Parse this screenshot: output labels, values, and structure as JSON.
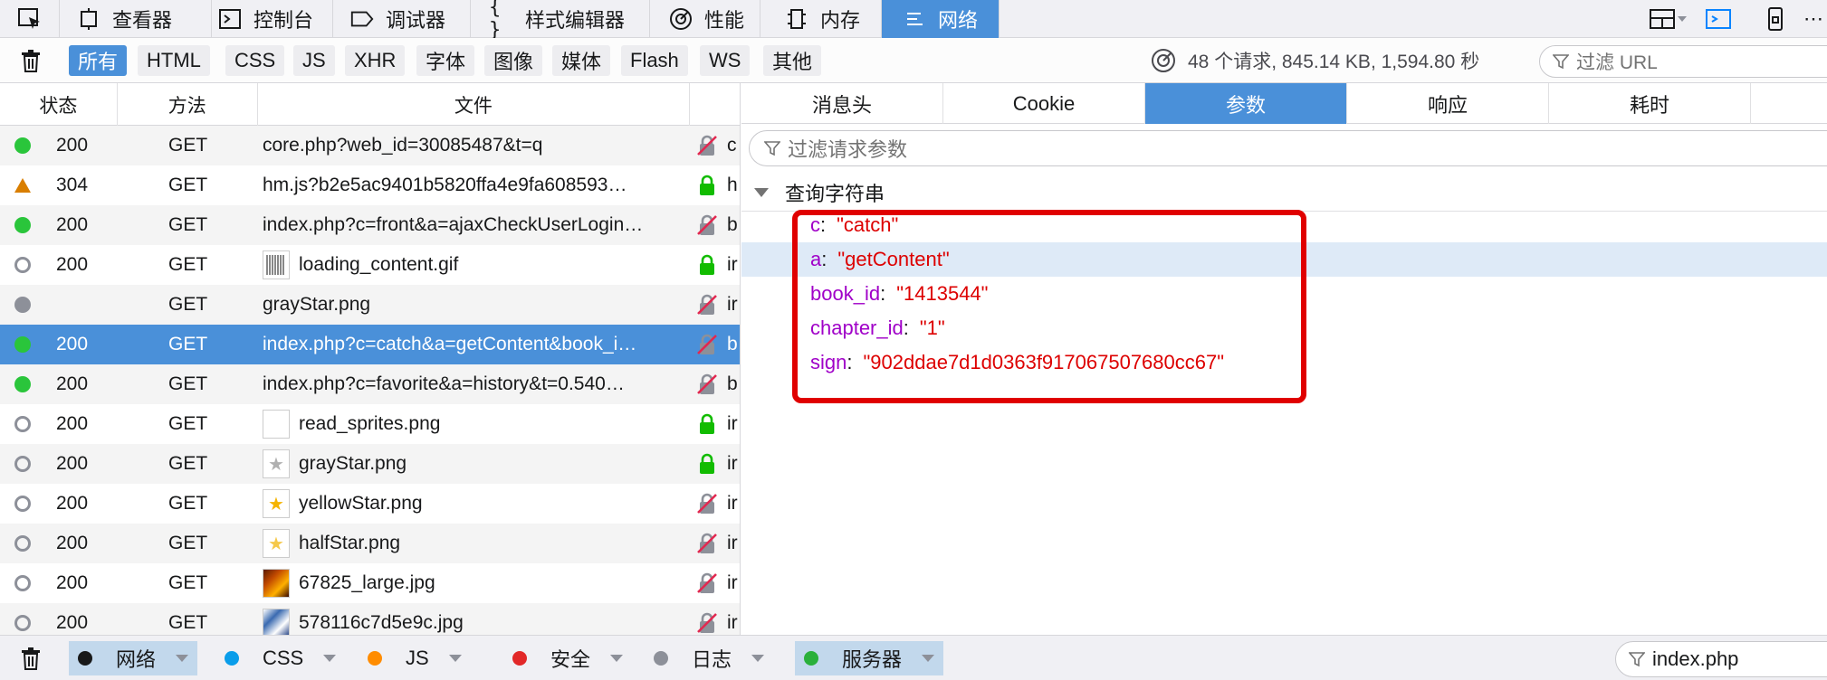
{
  "toolbar": {
    "tabs": [
      {
        "label": "查看器",
        "icon": "inspector-icon"
      },
      {
        "label": "控制台",
        "icon": "console-icon"
      },
      {
        "label": "调试器",
        "icon": "debugger-icon"
      },
      {
        "label": "样式编辑器",
        "icon": "style-editor-icon"
      },
      {
        "label": "性能",
        "icon": "performance-icon"
      },
      {
        "label": "内存",
        "icon": "memory-icon"
      },
      {
        "label": "网络",
        "icon": "network-icon",
        "active": true
      }
    ]
  },
  "filters": {
    "types": [
      "所有",
      "HTML",
      "CSS",
      "JS",
      "XHR",
      "字体",
      "图像",
      "媒体",
      "Flash",
      "WS",
      "其他"
    ],
    "active": "所有",
    "summary": "48 个请求, 845.14 KB, 1,594.80 秒",
    "url_placeholder": "过滤 URL"
  },
  "list": {
    "headers": [
      "状态",
      "方法",
      "文件"
    ],
    "rows": [
      {
        "status_icon": "green",
        "code": "200",
        "method": "GET",
        "file": "core.php?web_id=30085487&t=q",
        "secure": false,
        "domain": "c"
      },
      {
        "status_icon": "warning",
        "code": "304",
        "method": "GET",
        "file": "hm.js?b2e5ac9401b5820ffa4e9fa608593…",
        "secure": true,
        "domain": "h"
      },
      {
        "status_icon": "green",
        "code": "200",
        "method": "GET",
        "file": "index.php?c=front&a=ajaxCheckUserLogin…",
        "secure": false,
        "domain": "b"
      },
      {
        "status_icon": "hollow",
        "code": "200",
        "method": "GET",
        "file": "loading_content.gif",
        "thumb": "loading",
        "secure": true,
        "domain": "ir"
      },
      {
        "status_icon": "gray",
        "code": "",
        "method": "GET",
        "file": "grayStar.png",
        "secure": false,
        "domain": "ir"
      },
      {
        "status_icon": "green",
        "code": "200",
        "method": "GET",
        "file": "index.php?c=catch&a=getContent&book_i…",
        "secure": false,
        "domain": "b",
        "selected": true
      },
      {
        "status_icon": "green",
        "code": "200",
        "method": "GET",
        "file": "index.php?c=favorite&a=history&t=0.540…",
        "secure": false,
        "domain": "b"
      },
      {
        "status_icon": "hollow",
        "code": "200",
        "method": "GET",
        "file": "read_sprites.png",
        "thumb": "blank",
        "secure": true,
        "domain": "ir"
      },
      {
        "status_icon": "hollow",
        "code": "200",
        "method": "GET",
        "file": "grayStar.png",
        "thumb": "graystar",
        "secure": true,
        "domain": "ir"
      },
      {
        "status_icon": "hollow",
        "code": "200",
        "method": "GET",
        "file": "yellowStar.png",
        "thumb": "yellowstar",
        "secure": false,
        "domain": "ir"
      },
      {
        "status_icon": "hollow",
        "code": "200",
        "method": "GET",
        "file": "halfStar.png",
        "thumb": "halfstar",
        "secure": false,
        "domain": "ir"
      },
      {
        "status_icon": "hollow",
        "code": "200",
        "method": "GET",
        "file": "67825_large.jpg",
        "thumb": "photo",
        "secure": false,
        "domain": "ir"
      },
      {
        "status_icon": "hollow",
        "code": "200",
        "method": "GET",
        "file": "578116c7d5e9c.jpg",
        "thumb": "photo2",
        "secure": false,
        "domain": "ir"
      }
    ]
  },
  "panel": {
    "tabs": [
      "消息头",
      "Cookie",
      "参数",
      "响应",
      "耗时"
    ],
    "active_tab": "参数",
    "filter_placeholder": "过滤请求参数",
    "section_title": "查询字符串",
    "params": [
      {
        "key": "c",
        "value": "\"catch\""
      },
      {
        "key": "a",
        "value": "\"getContent\"",
        "highlighted": true
      },
      {
        "key": "book_id",
        "value": "\"1413544\""
      },
      {
        "key": "chapter_id",
        "value": "\"1\""
      },
      {
        "key": "sign",
        "value": "\"902ddae7d1d0363f917067507680cc67\""
      }
    ]
  },
  "console": {
    "filters": [
      {
        "label": "网络",
        "color": "#18191a",
        "on": true
      },
      {
        "label": "CSS",
        "color": "#0a9dea",
        "on": false
      },
      {
        "label": "JS",
        "color": "#ff8c00",
        "on": false
      },
      {
        "label": "安全",
        "color": "#e22828",
        "on": false
      },
      {
        "label": "日志",
        "color": "#8d9099",
        "on": false
      },
      {
        "label": "服务器",
        "color": "#2ab03b",
        "on": true
      }
    ],
    "filter_value": "index.php"
  },
  "colors": {
    "accent": "#4a90d9",
    "highlight": "#deeaf7",
    "param_key": "#a000c8",
    "param_value": "#dd0000",
    "annotation": "#e00000"
  }
}
